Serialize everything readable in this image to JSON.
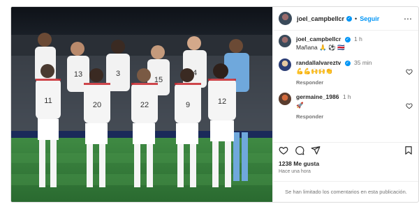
{
  "post": {
    "author": "joel_campbellcr",
    "follow_label": "Seguir",
    "caption_author": "joel_campbellcr",
    "caption_time": "1 h",
    "caption_text": "Mañana 🙏 ⚽ 🇨🇷",
    "likes": "1238 Me gusta",
    "posted_ago": "Hace una hora",
    "comments_limited": "Se han limitado los comentarios en esta publicación."
  },
  "comments": [
    {
      "user": "randallalvareztv",
      "time": "35 min",
      "text": "💪💪🙌🙌👏",
      "reply_label": "Responder"
    },
    {
      "user": "germaine_1986",
      "time": "1 h",
      "text": "🚀",
      "reply_label": "Responder"
    }
  ],
  "photo": {
    "jersey_numbers": [
      "13",
      "3",
      "15",
      "4",
      "11",
      "20",
      "22",
      "9",
      "12"
    ]
  },
  "colors": {
    "accent": "#0095f6",
    "text": "#262626",
    "muted": "#737373",
    "jersey": "#f2f2f2",
    "shorts": "#ffffff",
    "socks": "#f5f5f5",
    "keeper": "#6fa8dc",
    "pitch": "#2f7a37"
  }
}
